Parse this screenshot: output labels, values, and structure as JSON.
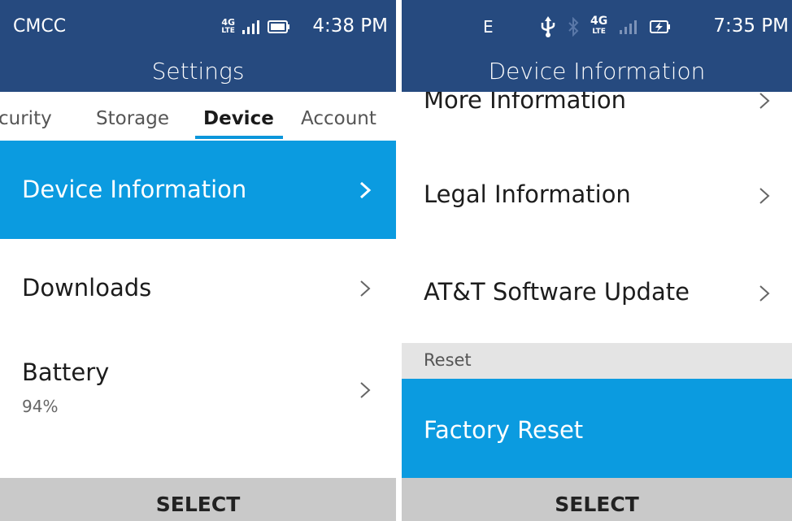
{
  "left_screen": {
    "status": {
      "carrier": "CMCC",
      "network": "4G",
      "network_sub": "LTE",
      "time": "4:38 PM"
    },
    "title": "Settings",
    "tabs": [
      {
        "label": "Security",
        "visible_text": "curity"
      },
      {
        "label": "Storage"
      },
      {
        "label": "Device"
      },
      {
        "label": "Account"
      }
    ],
    "active_tab": "Device",
    "items": [
      {
        "label": "Device Information",
        "selected": true
      },
      {
        "label": "Downloads",
        "selected": false
      },
      {
        "label": "Battery",
        "value": "94%",
        "selected": false
      }
    ],
    "softkey": "SELECT"
  },
  "right_screen": {
    "status": {
      "left_indicator": "E",
      "network": "4G",
      "network_sub": "LTE",
      "time": "7:35 PM"
    },
    "title": "Device Information",
    "items": [
      {
        "label": "More Information",
        "selected": false
      },
      {
        "label": "Legal Information",
        "selected": false
      },
      {
        "label": "AT&T Software Update",
        "selected": false
      }
    ],
    "section_header": "Reset",
    "reset_items": [
      {
        "label": "Factory Reset",
        "selected": true
      }
    ],
    "softkey": "SELECT"
  },
  "colors": {
    "header_bg": "#264a7f",
    "selection": "#0b9be0",
    "tab_underline": "#0b96db",
    "section_bg": "#e4e4e4",
    "softkey_bg": "#c9c9c9"
  },
  "icons": [
    "signal-icon",
    "battery-icon",
    "battery-charging-icon",
    "usb-icon",
    "bluetooth-icon",
    "chevron-right-icon"
  ]
}
